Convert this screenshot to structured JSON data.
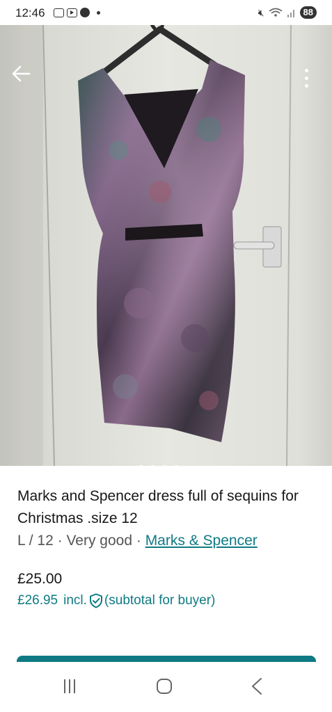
{
  "status_bar": {
    "time": "12:46",
    "battery": "88",
    "icons": [
      "screenshot-icon",
      "youtube-icon",
      "messenger-icon",
      "dot-icon",
      "mute-icon",
      "wifi-icon",
      "signal-icon",
      "battery-icon"
    ]
  },
  "photo": {
    "alt_subject": "sequin dress on hanger",
    "carousel_count": 5,
    "carousel_active": 1
  },
  "listing": {
    "title": "Marks and Spencer dress full of sequins for Christmas .size 12",
    "size": "L / 12",
    "sep1": " · ",
    "condition": "Very good",
    "sep2": " · ",
    "brand": "Marks & Spencer",
    "price": "£25.00",
    "buyer_price": "£26.95",
    "buyer_incl": "incl.",
    "buyer_note": "(subtotal for buyer)"
  },
  "colors": {
    "accent": "#0f7a83"
  }
}
